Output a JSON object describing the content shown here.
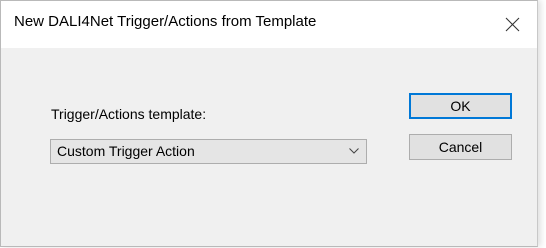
{
  "window": {
    "title": "New DALI4Net Trigger/Actions from Template"
  },
  "form": {
    "template_label": "Trigger/Actions template:",
    "template_selected": "Custom Trigger Action"
  },
  "buttons": {
    "ok_label": "OK",
    "cancel_label": "Cancel"
  },
  "icons": {
    "close": "close-icon",
    "dropdown": "chevron-down-icon"
  },
  "colors": {
    "default_button_border": "#0078d7",
    "dialog_background": "#f0f0f0",
    "titlebar_background": "#ffffff"
  }
}
